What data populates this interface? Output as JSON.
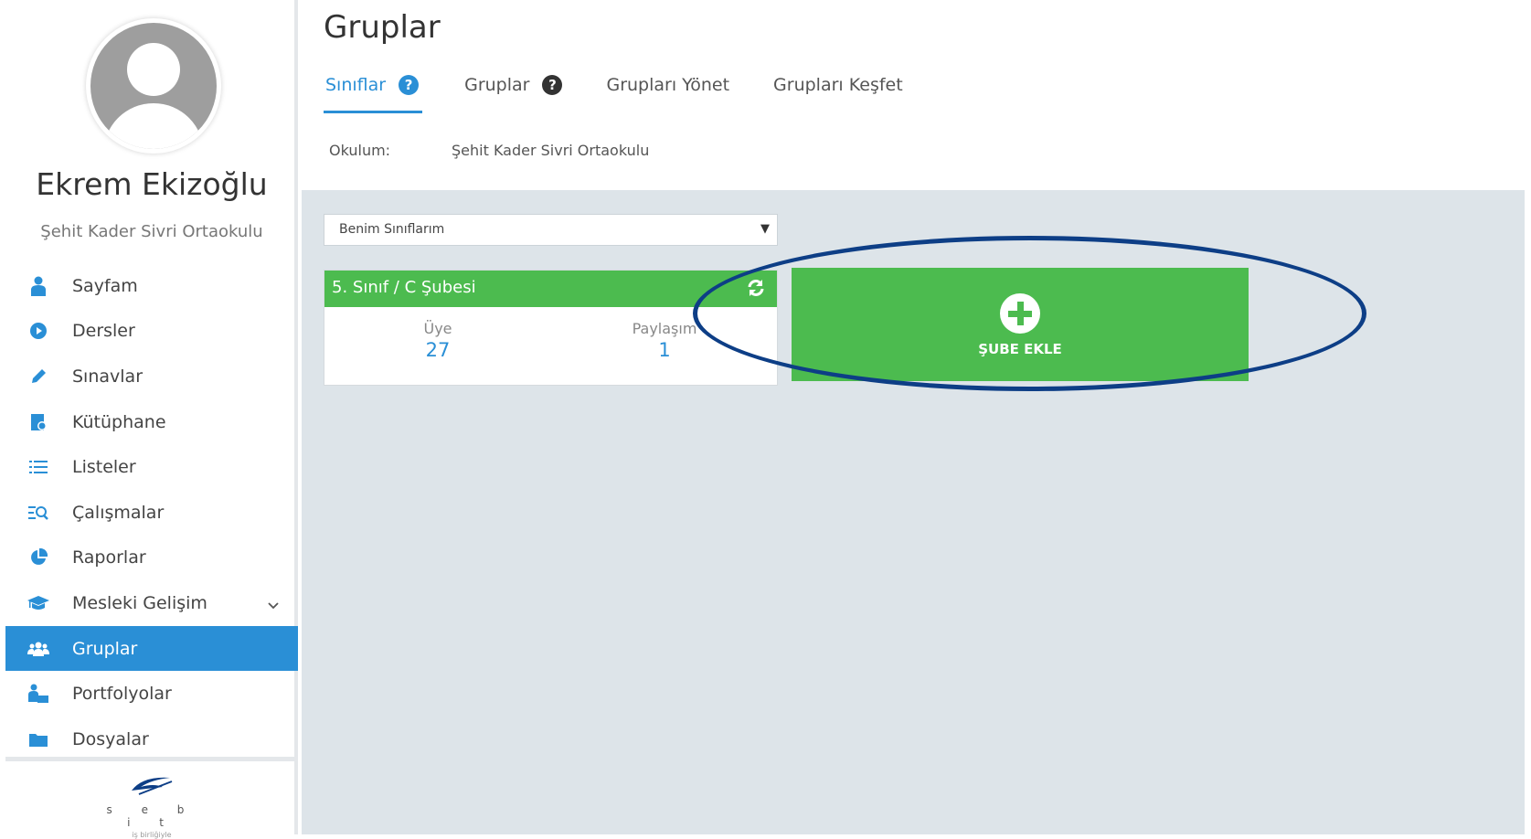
{
  "user": {
    "name": "Ekrem Ekizoğlu",
    "school": "Şehit Kader Sivri Ortaokulu"
  },
  "sidebar": {
    "items": [
      {
        "label": "Sayfam",
        "icon": "user-icon"
      },
      {
        "label": "Dersler",
        "icon": "play-circle-icon"
      },
      {
        "label": "Sınavlar",
        "icon": "pencil-icon"
      },
      {
        "label": "Kütüphane",
        "icon": "library-icon"
      },
      {
        "label": "Listeler",
        "icon": "list-icon"
      },
      {
        "label": "Çalışmalar",
        "icon": "search-list-icon"
      },
      {
        "label": "Raporlar",
        "icon": "pie-chart-icon"
      },
      {
        "label": "Mesleki Gelişim",
        "icon": "graduation-cap-icon"
      },
      {
        "label": "Gruplar",
        "icon": "users-icon"
      },
      {
        "label": "Portfolyolar",
        "icon": "portfolio-icon"
      },
      {
        "label": "Dosyalar",
        "icon": "folder-icon"
      }
    ],
    "active_index": 8
  },
  "footer": {
    "logo_letters": "s e b i t",
    "logo_tagline": "iş birliğiyle"
  },
  "header": {
    "title": "Gruplar",
    "tabs": [
      {
        "label": "Sınıflar"
      },
      {
        "label": "Gruplar"
      },
      {
        "label": "Grupları Yönet"
      },
      {
        "label": "Grupları Keşfet"
      }
    ],
    "school_label": "Okulum:",
    "school_value": "Şehit Kader Sivri Ortaokulu"
  },
  "filter": {
    "selected": "Benim Sınıflarım"
  },
  "class_card": {
    "title": "5. Sınıf / C Şubesi",
    "stats": [
      {
        "label": "Üye",
        "value": "27"
      },
      {
        "label": "Paylaşım",
        "value": "1"
      }
    ]
  },
  "add_card": {
    "label": "ŞUBE EKLE"
  },
  "colors": {
    "accent": "#2a8fd6",
    "green": "#4cbb4f",
    "annotation": "#0d3e86"
  }
}
